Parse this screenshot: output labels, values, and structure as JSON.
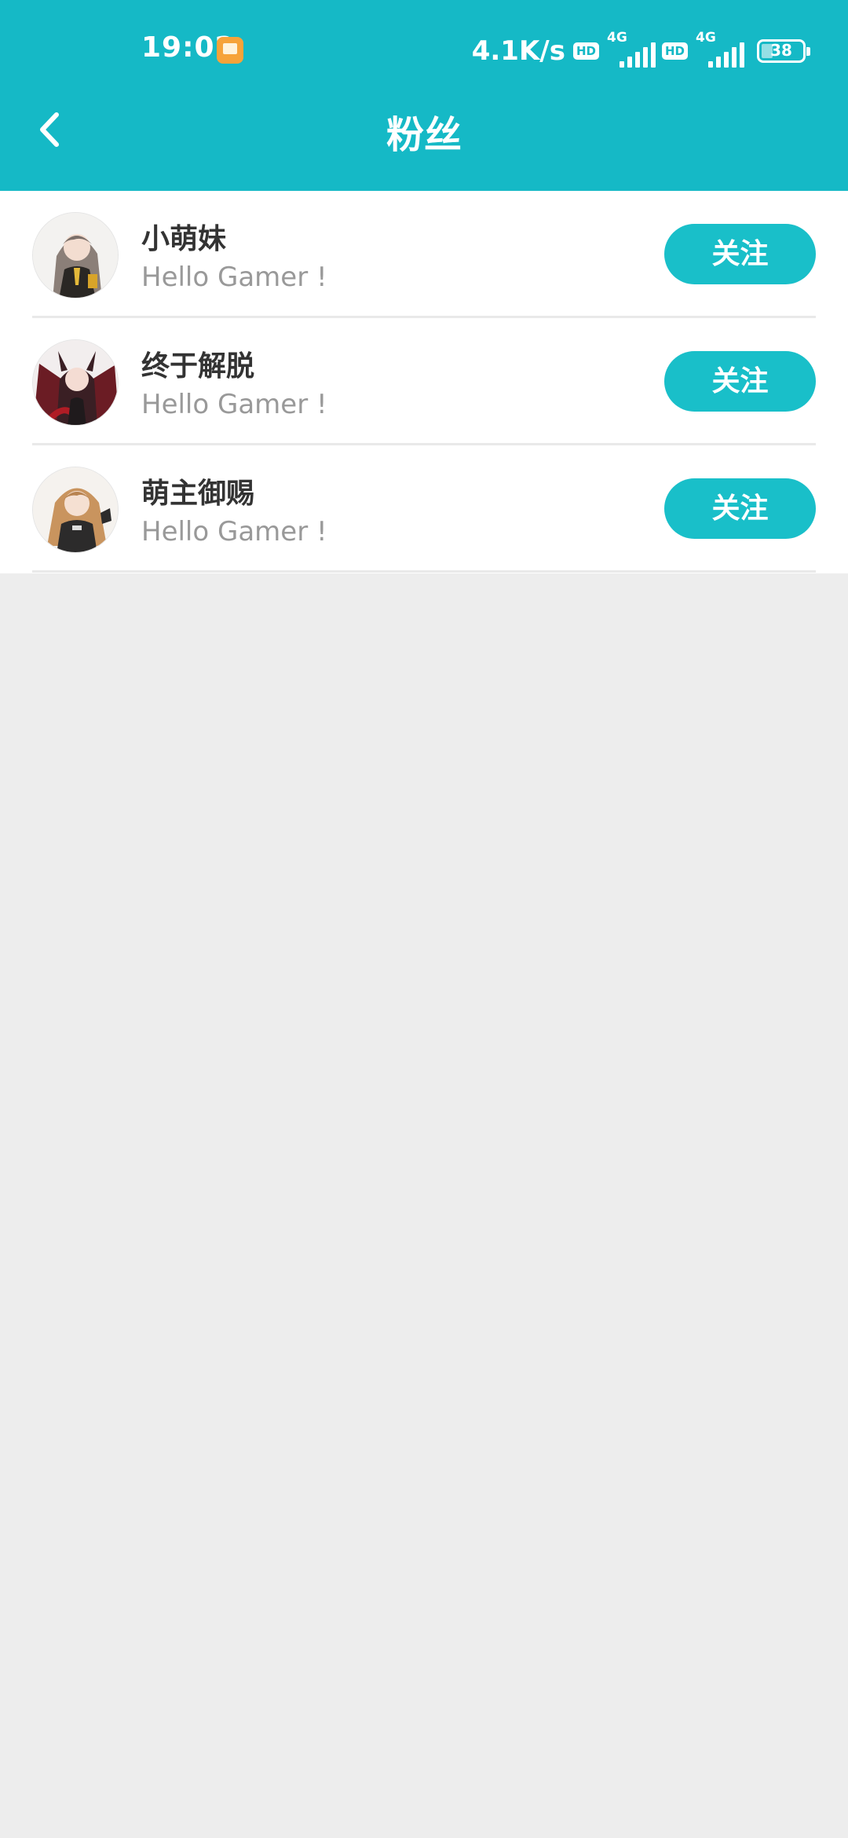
{
  "status_bar": {
    "time": "19:02",
    "network_speed": "4.1K/s",
    "sim1": {
      "hd": "HD",
      "net": "4G"
    },
    "sim2": {
      "hd": "HD",
      "net": "4G"
    },
    "battery_level": "38"
  },
  "header": {
    "title": "粉丝",
    "background_color": "#15b9c6"
  },
  "fans": [
    {
      "name": "小萌妹",
      "bio": "Hello Gamer !",
      "follow_label": "关注",
      "avatar_hair_color": "#8b7f78",
      "avatar_outfit_color": "#2a2724"
    },
    {
      "name": "终于解脱",
      "bio": "Hello Gamer !",
      "follow_label": "关注",
      "avatar_hair_color": "#3a1f24",
      "avatar_outfit_color": "#b01c25"
    },
    {
      "name": "萌主御赐",
      "bio": "Hello Gamer !",
      "follow_label": "关注",
      "avatar_hair_color": "#c9945e",
      "avatar_outfit_color": "#2c2b2b"
    }
  ],
  "colors": {
    "accent": "#19bfc9",
    "page_background": "#ededed"
  }
}
